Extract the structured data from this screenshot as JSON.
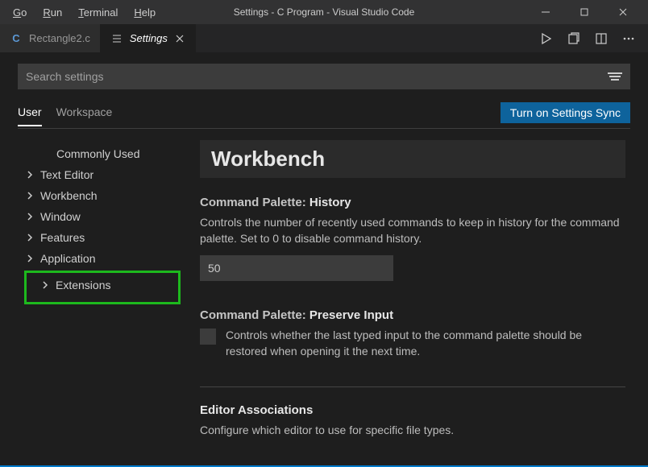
{
  "window": {
    "title": "Settings - C Program - Visual Studio Code"
  },
  "menu": {
    "go": "Go",
    "run": "Run",
    "terminal": "Terminal",
    "help": "Help"
  },
  "tabs": {
    "file_tab": "Rectangle2.c",
    "settings_tab": "Settings"
  },
  "search": {
    "placeholder": "Search settings"
  },
  "scope": {
    "user": "User",
    "workspace": "Workspace",
    "sync_button": "Turn on Settings Sync"
  },
  "tree": {
    "commonly_used": "Commonly Used",
    "text_editor": "Text Editor",
    "workbench": "Workbench",
    "window": "Window",
    "features": "Features",
    "application": "Application",
    "extensions": "Extensions"
  },
  "content": {
    "section": "Workbench",
    "setting1": {
      "category": "Command Palette:",
      "name": "History",
      "desc": "Controls the number of recently used commands to keep in history for the command palette. Set to 0 to disable command history.",
      "value": "50"
    },
    "setting2": {
      "category": "Command Palette:",
      "name": "Preserve Input",
      "desc": "Controls whether the last typed input to the command palette should be restored when opening it the next time."
    },
    "setting3": {
      "name": "Editor Associations",
      "desc": "Configure which editor to use for specific file types."
    }
  }
}
